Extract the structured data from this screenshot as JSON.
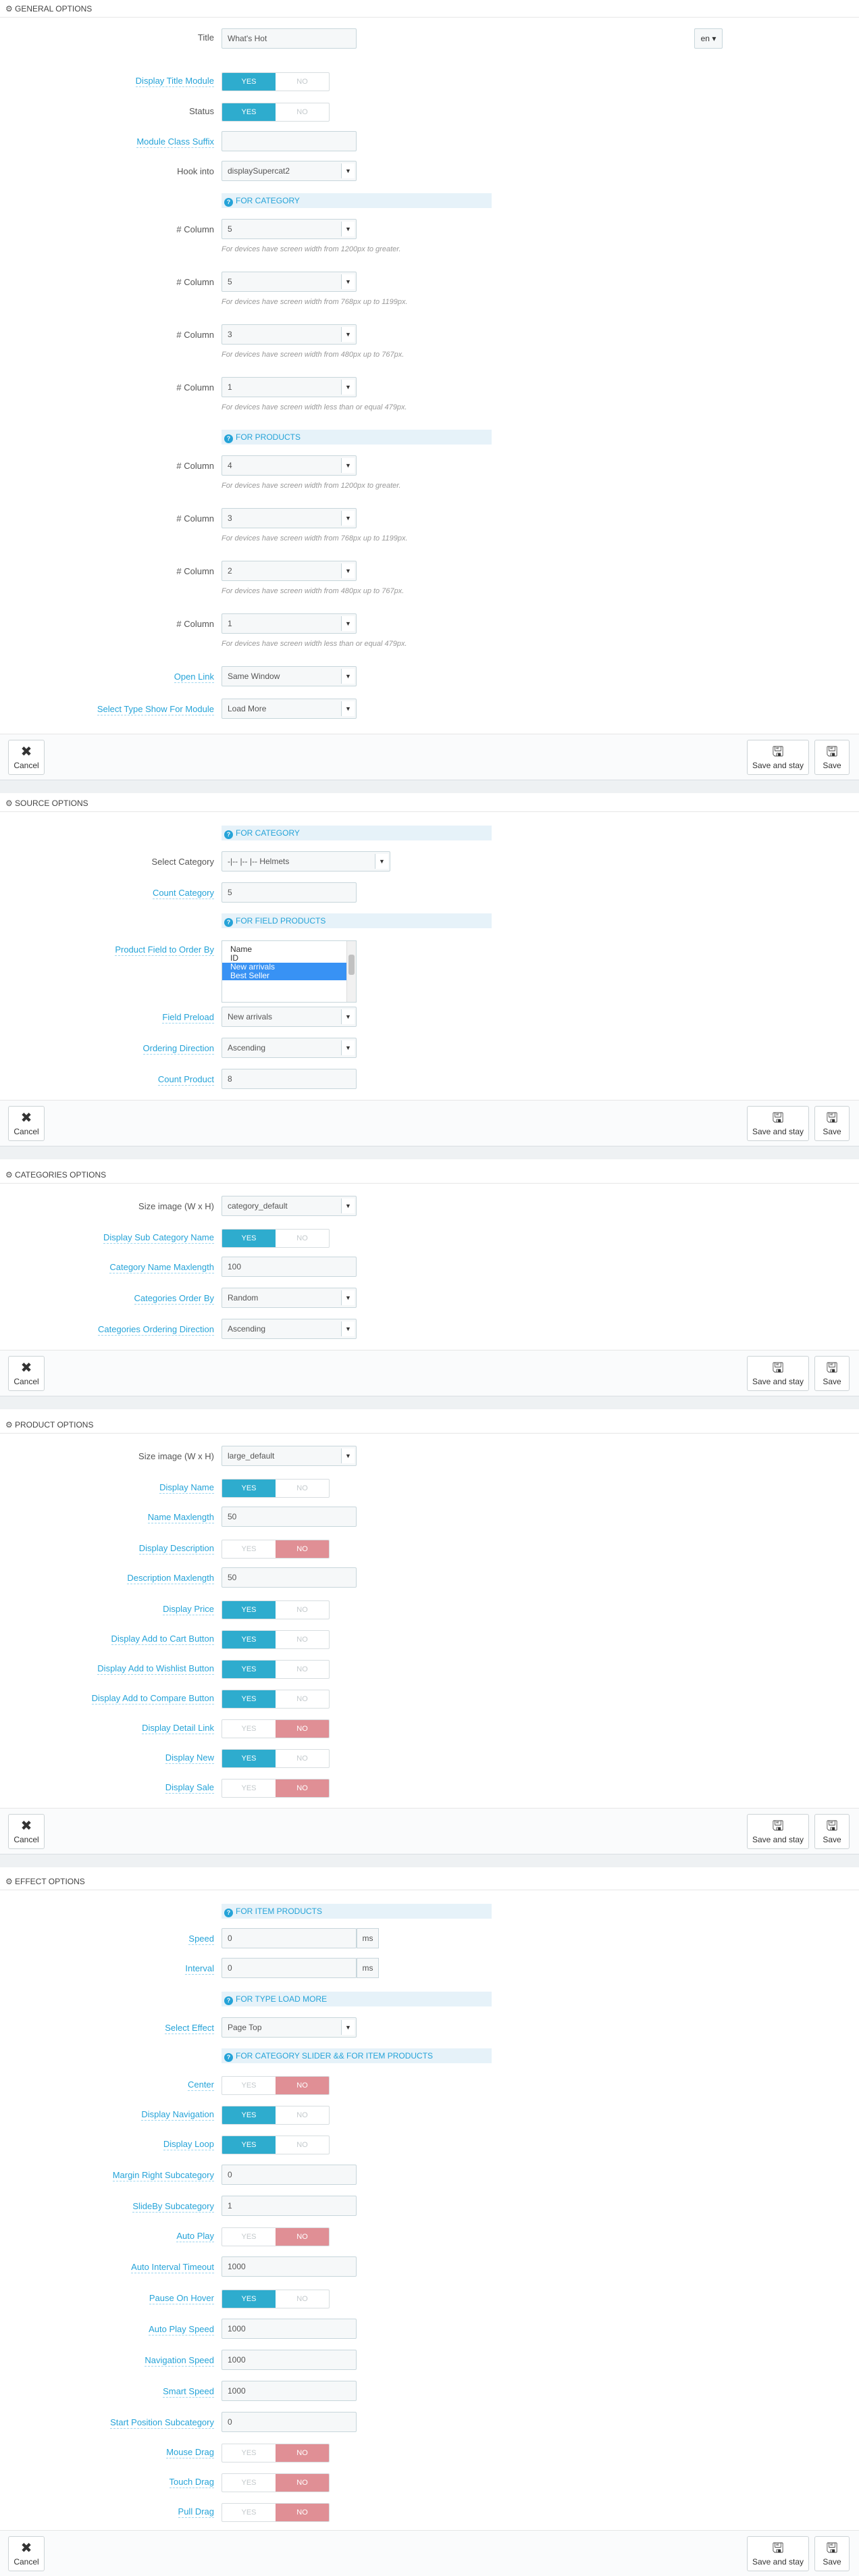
{
  "general": {
    "header": "GENERAL OPTIONS",
    "title_label": "Title",
    "title_value": "What's Hot",
    "lang": "en",
    "display_title_label": "Display Title Module",
    "status_label": "Status",
    "class_suffix_label": "Module Class Suffix",
    "class_suffix_value": "",
    "hook_label": "Hook into",
    "hook_value": "displaySupercat2",
    "for_category": "FOR CATEGORY",
    "for_products": "FOR PRODUCTS",
    "column_label": "# Column",
    "help1": "For devices have screen width from 1200px to greater.",
    "help2": "For devices have screen width from 768px up to 1199px.",
    "help3": "For devices have screen width from 480px up to 767px.",
    "help4": "For devices have screen width less than or equal 479px.",
    "cat_cols": [
      "5",
      "5",
      "3",
      "1"
    ],
    "prod_cols": [
      "4",
      "3",
      "2",
      "1"
    ],
    "open_link_label": "Open Link",
    "open_link_value": "Same Window",
    "type_show_label": "Select Type Show For Module",
    "type_show_value": "Load More"
  },
  "buttons": {
    "cancel": "Cancel",
    "save_stay": "Save and stay",
    "save": "Save"
  },
  "switch": {
    "yes": "YES",
    "no": "NO"
  },
  "source": {
    "header": "SOURCE OPTIONS",
    "for_category": "FOR CATEGORY",
    "select_category_label": "Select Category",
    "select_category_value": "-|-- |-- |-- Helmets",
    "count_category_label": "Count Category",
    "count_category_value": "5",
    "for_field_products": "FOR FIELD PRODUCTS",
    "order_by_label": "Product Field to Order By",
    "order_by_options": [
      "Name",
      "ID",
      "New arrivals",
      "Best Seller"
    ],
    "field_preload_label": "Field Preload",
    "field_preload_value": "New arrivals",
    "ordering_label": "Ordering Direction",
    "ordering_value": "Ascending",
    "count_product_label": "Count Product",
    "count_product_value": "8"
  },
  "categories": {
    "header": "CATEGORIES OPTIONS",
    "size_label": "Size image (W x H)",
    "size_value": "category_default",
    "display_sub_label": "Display Sub Category Name",
    "maxlength_label": "Category Name Maxlength",
    "maxlength_value": "100",
    "order_by_label": "Categories Order By",
    "order_by_value": "Random",
    "ordering_label": "Categories Ordering Direction",
    "ordering_value": "Ascending"
  },
  "product": {
    "header": "PRODUCT OPTIONS",
    "size_label": "Size image (W x H)",
    "size_value": "large_default",
    "display_name_label": "Display Name",
    "name_max_label": "Name Maxlength",
    "name_max_value": "50",
    "display_desc_label": "Display Description",
    "desc_max_label": "Description Maxlength",
    "desc_max_value": "50",
    "display_price_label": "Display Price",
    "cart_label": "Display Add to Cart Button",
    "wishlist_label": "Display Add to Wishlist Button",
    "compare_label": "Display Add to Compare Button",
    "detail_label": "Display Detail Link",
    "new_label": "Display New",
    "sale_label": "Display Sale"
  },
  "effect": {
    "header": "EFFECT OPTIONS",
    "for_item": "FOR ITEM PRODUCTS",
    "speed_label": "Speed",
    "speed_value": "0",
    "ms": "ms",
    "interval_label": "Interval",
    "interval_value": "0",
    "for_load_more": "FOR TYPE LOAD MORE",
    "effect_label": "Select Effect",
    "effect_value": "Page Top",
    "for_slider": "FOR CATEGORY SLIDER && FOR ITEM PRODUCTS",
    "center_label": "Center",
    "nav_label": "Display Navigation",
    "loop_label": "Display Loop",
    "margin_label": "Margin Right Subcategory",
    "margin_value": "0",
    "slideby_label": "SlideBy Subcategory",
    "slideby_value": "1",
    "autoplay_label": "Auto Play",
    "auto_interval_label": "Auto Interval Timeout",
    "auto_interval_value": "1000",
    "pause_label": "Pause On Hover",
    "autoplay_speed_label": "Auto Play Speed",
    "autoplay_speed_value": "1000",
    "nav_speed_label": "Navigation Speed",
    "nav_speed_value": "1000",
    "smart_speed_label": "Smart Speed",
    "smart_speed_value": "1000",
    "start_pos_label": "Start Position Subcategory",
    "start_pos_value": "0",
    "mouse_drag_label": "Mouse Drag",
    "touch_drag_label": "Touch Drag",
    "pull_drag_label": "Pull Drag"
  }
}
